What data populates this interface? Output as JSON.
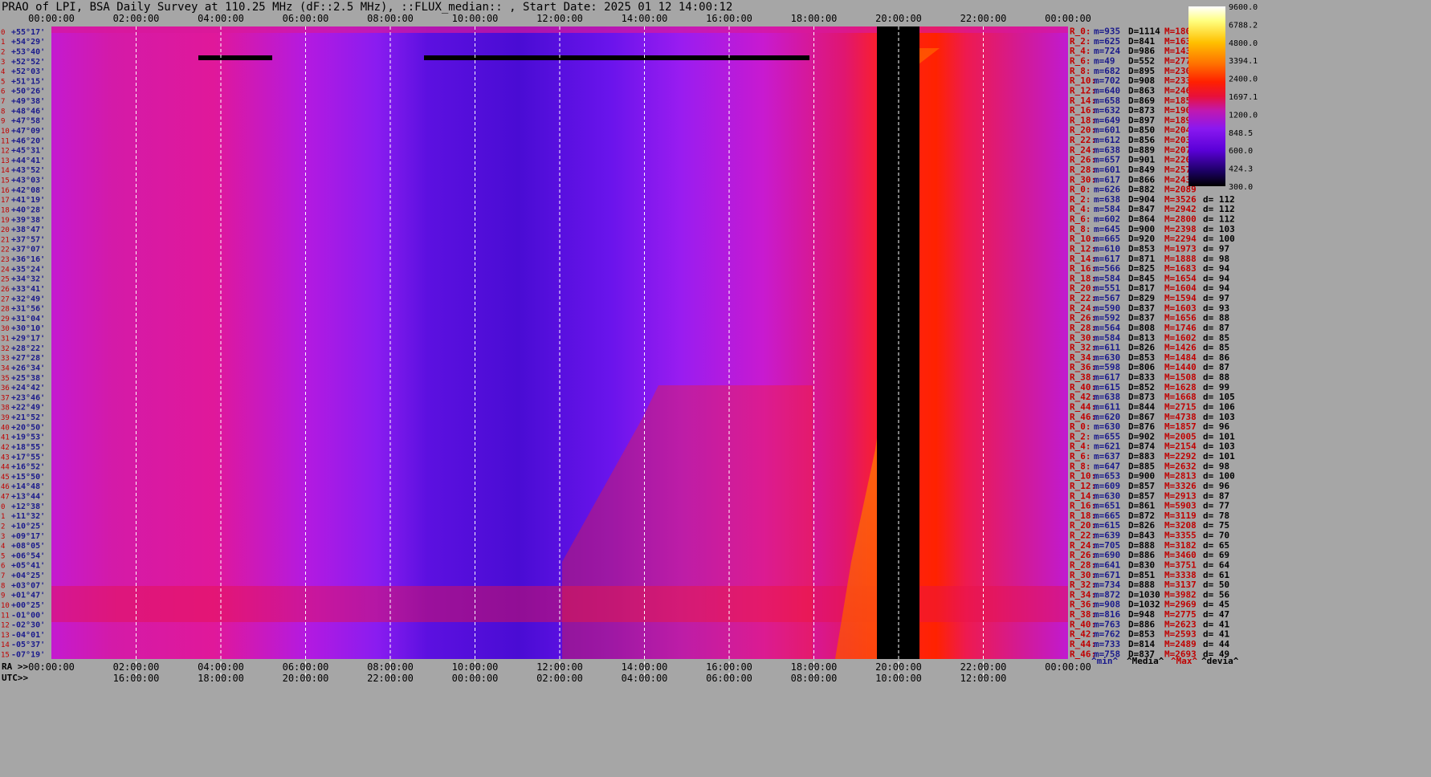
{
  "header": {
    "title": "PRAO of LPI, BSA Daily Survey at 110.25 MHz (dF::2.5 MHz), ::FLUX_median:: , Start Date: 2025 01 12 14:00:12"
  },
  "chart_data": {
    "type": "heatmap",
    "title": "PRAO of LPI, BSA Daily Survey at 110.25 MHz (dF::2.5 MHz), ::FLUX_median:: , Start Date: 2025 01 12 14:00:12",
    "x_axis_ra": {
      "prefix": "RA >>",
      "ticks": [
        "00:00:00",
        "02:00:00",
        "04:00:00",
        "06:00:00",
        "08:00:00",
        "10:00:00",
        "12:00:00",
        "14:00:00",
        "16:00:00",
        "18:00:00",
        "20:00:00",
        "22:00:00",
        "00:00:00"
      ],
      "range_hours": [
        0,
        24
      ]
    },
    "x_axis_utc": {
      "prefix": "UTC>>",
      "ticks": [
        "16:00:00",
        "18:00:00",
        "20:00:00",
        "22:00:00",
        "00:00:00",
        "02:00:00",
        "04:00:00",
        "06:00:00",
        "08:00:00",
        "10:00:00",
        "12:00:00"
      ]
    },
    "y_axis_declinations": [
      "+55°17'",
      "+54°29'",
      "+53°40'",
      "+52°52'",
      "+52°03'",
      "+51°15'",
      "+50°26'",
      "+49°38'",
      "+48°46'",
      "+47°58'",
      "+47°09'",
      "+46°20'",
      "+45°31'",
      "+44°41'",
      "+43°52'",
      "+43°03'",
      "+42°08'",
      "+41°19'",
      "+40°28'",
      "+39°38'",
      "+38°47'",
      "+37°57'",
      "+37°07'",
      "+36°16'",
      "+35°24'",
      "+34°32'",
      "+33°41'",
      "+32°49'",
      "+31°56'",
      "+31°04'",
      "+30°10'",
      "+29°17'",
      "+28°22'",
      "+27°28'",
      "+26°34'",
      "+25°38'",
      "+24°42'",
      "+23°46'",
      "+22°49'",
      "+21°52'",
      "+20°50'",
      "+19°53'",
      "+18°55'",
      "+17°55'",
      "+16°52'",
      "+15°50'",
      "+14°48'",
      "+13°44'",
      "+12°38'",
      "+11°32'",
      "+10°25'",
      "+09°17'",
      "+08°05'",
      "+06°54'",
      "+05°41'",
      "+04°25'",
      "+03°07'",
      "+01°47'",
      "+00°25'",
      "-01°00'",
      "-02°30'",
      "-04°01'",
      "-05°37'",
      "-07°19'"
    ],
    "colorbar": {
      "ticks": [
        "9600.0",
        "6788.2",
        "4800.0",
        "3394.1",
        "2400.0",
        "1697.1",
        "1200.0",
        "848.5",
        "600.0",
        "424.3",
        "300.0"
      ],
      "range": [
        300,
        9600
      ],
      "scale": "log",
      "colormap": [
        "#000000",
        "#1a0060",
        "#5a00d8",
        "#8a18f0",
        "#c018b0",
        "#e8103a",
        "#ff2000",
        "#ff7000",
        "#ffc000",
        "#ffff80",
        "#ffffff"
      ]
    },
    "stats": [
      {
        "r": "R_0:",
        "m": "m=935",
        "d": "D=1114",
        "h": "M=180",
        "dv": ""
      },
      {
        "r": "R_2:",
        "m": "m=625",
        "d": "D=841",
        "h": "M=1630",
        "dv": ""
      },
      {
        "r": "R_4:",
        "m": "m=724",
        "d": "D=986",
        "h": "M=1430",
        "dv": ""
      },
      {
        "r": "R_6:",
        "m": "m=49",
        "d": "D=552",
        "h": "M=2774",
        "dv": ""
      },
      {
        "r": "R_8:",
        "m": "m=682",
        "d": "D=895",
        "h": "M=2304",
        "dv": ""
      },
      {
        "r": "R_10:",
        "m": "m=702",
        "d": "D=908",
        "h": "M=233",
        "dv": ""
      },
      {
        "r": "R_12:",
        "m": "m=640",
        "d": "D=863",
        "h": "M=246",
        "dv": ""
      },
      {
        "r": "R_14:",
        "m": "m=658",
        "d": "D=869",
        "h": "M=185",
        "dv": ""
      },
      {
        "r": "R_16:",
        "m": "m=632",
        "d": "D=873",
        "h": "M=190",
        "dv": ""
      },
      {
        "r": "R_18:",
        "m": "m=649",
        "d": "D=897",
        "h": "M=189",
        "dv": ""
      },
      {
        "r": "R_20:",
        "m": "m=601",
        "d": "D=850",
        "h": "M=204",
        "dv": ""
      },
      {
        "r": "R_22:",
        "m": "m=612",
        "d": "D=856",
        "h": "M=203",
        "dv": ""
      },
      {
        "r": "R_24:",
        "m": "m=638",
        "d": "D=889",
        "h": "M=207",
        "dv": ""
      },
      {
        "r": "R_26:",
        "m": "m=657",
        "d": "D=901",
        "h": "M=220",
        "dv": ""
      },
      {
        "r": "R_28:",
        "m": "m=601",
        "d": "D=849",
        "h": "M=257",
        "dv": ""
      },
      {
        "r": "R_30:",
        "m": "m=617",
        "d": "D=866",
        "h": "M=243",
        "dv": ""
      },
      {
        "r": "R_0:",
        "m": "m=626",
        "d": "D=882",
        "h": "M=2089",
        "dv": ""
      },
      {
        "r": "R_2:",
        "m": "m=638",
        "d": "D=904",
        "h": "M=3526",
        "dv": "d= 112"
      },
      {
        "r": "R_4:",
        "m": "m=584",
        "d": "D=847",
        "h": "M=2942",
        "dv": "d= 112"
      },
      {
        "r": "R_6:",
        "m": "m=602",
        "d": "D=864",
        "h": "M=2800",
        "dv": "d= 112"
      },
      {
        "r": "R_8:",
        "m": "m=645",
        "d": "D=900",
        "h": "M=2398",
        "dv": "d= 103"
      },
      {
        "r": "R_10:",
        "m": "m=665",
        "d": "D=920",
        "h": "M=2294",
        "dv": "d= 100"
      },
      {
        "r": "R_12:",
        "m": "m=610",
        "d": "D=853",
        "h": "M=1973",
        "dv": "d= 97"
      },
      {
        "r": "R_14:",
        "m": "m=617",
        "d": "D=871",
        "h": "M=1888",
        "dv": "d= 98"
      },
      {
        "r": "R_16:",
        "m": "m=566",
        "d": "D=825",
        "h": "M=1683",
        "dv": "d= 94"
      },
      {
        "r": "R_18:",
        "m": "m=584",
        "d": "D=845",
        "h": "M=1654",
        "dv": "d= 94"
      },
      {
        "r": "R_20:",
        "m": "m=551",
        "d": "D=817",
        "h": "M=1604",
        "dv": "d= 94"
      },
      {
        "r": "R_22:",
        "m": "m=567",
        "d": "D=829",
        "h": "M=1594",
        "dv": "d= 97"
      },
      {
        "r": "R_24:",
        "m": "m=590",
        "d": "D=837",
        "h": "M=1603",
        "dv": "d= 93"
      },
      {
        "r": "R_26:",
        "m": "m=592",
        "d": "D=837",
        "h": "M=1656",
        "dv": "d= 88"
      },
      {
        "r": "R_28:",
        "m": "m=564",
        "d": "D=808",
        "h": "M=1746",
        "dv": "d= 87"
      },
      {
        "r": "R_30:",
        "m": "m=584",
        "d": "D=813",
        "h": "M=1602",
        "dv": "d= 85"
      },
      {
        "r": "R_32:",
        "m": "m=611",
        "d": "D=826",
        "h": "M=1426",
        "dv": "d= 85"
      },
      {
        "r": "R_34:",
        "m": "m=630",
        "d": "D=853",
        "h": "M=1484",
        "dv": "d= 86"
      },
      {
        "r": "R_36:",
        "m": "m=598",
        "d": "D=806",
        "h": "M=1440",
        "dv": "d= 87"
      },
      {
        "r": "R_38:",
        "m": "m=617",
        "d": "D=833",
        "h": "M=1508",
        "dv": "d= 88"
      },
      {
        "r": "R_40:",
        "m": "m=615",
        "d": "D=852",
        "h": "M=1628",
        "dv": "d= 99"
      },
      {
        "r": "R_42:",
        "m": "m=638",
        "d": "D=873",
        "h": "M=1668",
        "dv": "d= 105"
      },
      {
        "r": "R_44:",
        "m": "m=611",
        "d": "D=844",
        "h": "M=2715",
        "dv": "d= 106"
      },
      {
        "r": "R_46:",
        "m": "m=620",
        "d": "D=867",
        "h": "M=4738",
        "dv": "d= 103"
      },
      {
        "r": "R_0:",
        "m": "m=630",
        "d": "D=876",
        "h": "M=1857",
        "dv": "d= 96"
      },
      {
        "r": "R_2:",
        "m": "m=655",
        "d": "D=902",
        "h": "M=2005",
        "dv": "d= 101"
      },
      {
        "r": "R_4:",
        "m": "m=621",
        "d": "D=874",
        "h": "M=2154",
        "dv": "d= 103"
      },
      {
        "r": "R_6:",
        "m": "m=637",
        "d": "D=883",
        "h": "M=2292",
        "dv": "d= 101"
      },
      {
        "r": "R_8:",
        "m": "m=647",
        "d": "D=885",
        "h": "M=2632",
        "dv": "d= 98"
      },
      {
        "r": "R_10:",
        "m": "m=653",
        "d": "D=900",
        "h": "M=2813",
        "dv": "d= 100"
      },
      {
        "r": "R_12:",
        "m": "m=609",
        "d": "D=857",
        "h": "M=3326",
        "dv": "d= 96"
      },
      {
        "r": "R_14:",
        "m": "m=630",
        "d": "D=857",
        "h": "M=2913",
        "dv": "d= 87"
      },
      {
        "r": "R_16:",
        "m": "m=651",
        "d": "D=861",
        "h": "M=5903",
        "dv": "d= 77"
      },
      {
        "r": "R_18:",
        "m": "m=665",
        "d": "D=872",
        "h": "M=3119",
        "dv": "d= 78"
      },
      {
        "r": "R_20:",
        "m": "m=615",
        "d": "D=826",
        "h": "M=3208",
        "dv": "d= 75"
      },
      {
        "r": "R_22:",
        "m": "m=639",
        "d": "D=843",
        "h": "M=3355",
        "dv": "d= 70"
      },
      {
        "r": "R_24:",
        "m": "m=705",
        "d": "D=888",
        "h": "M=3182",
        "dv": "d= 65"
      },
      {
        "r": "R_26:",
        "m": "m=690",
        "d": "D=886",
        "h": "M=3460",
        "dv": "d= 69"
      },
      {
        "r": "R_28:",
        "m": "m=641",
        "d": "D=830",
        "h": "M=3751",
        "dv": "d= 64"
      },
      {
        "r": "R_30:",
        "m": "m=671",
        "d": "D=851",
        "h": "M=3338",
        "dv": "d= 61"
      },
      {
        "r": "R_32:",
        "m": "m=734",
        "d": "D=888",
        "h": "M=3137",
        "dv": "d= 50"
      },
      {
        "r": "R_34:",
        "m": "m=872",
        "d": "D=1030",
        "h": "M=3982",
        "dv": "d= 56"
      },
      {
        "r": "R_36:",
        "m": "m=908",
        "d": "D=1032",
        "h": "M=2969",
        "dv": "d= 45"
      },
      {
        "r": "R_38:",
        "m": "m=816",
        "d": "D=948",
        "h": "M=2775",
        "dv": "d= 47"
      },
      {
        "r": "R_40:",
        "m": "m=763",
        "d": "D=886",
        "h": "M=2623",
        "dv": "d= 41"
      },
      {
        "r": "R_42:",
        "m": "m=762",
        "d": "D=853",
        "h": "M=2593",
        "dv": "d= 41"
      },
      {
        "r": "R_44:",
        "m": "m=733",
        "d": "D=814",
        "h": "M=2489",
        "dv": "d= 44"
      },
      {
        "r": "R_46:",
        "m": "m=758",
        "d": "D=837",
        "h": "M=2693",
        "dv": "d= 49"
      }
    ],
    "stats_legend": [
      "^min^",
      "^Media^",
      "^Max^",
      "^devia^"
    ],
    "colors": {
      "background": "#a6a6a6",
      "region_label": "#c00000",
      "min_label": "#1a1a8c",
      "media_label": "#000000",
      "max_label": "#c00000",
      "devia_label": "#000000",
      "gridline": "#ffffff"
    }
  }
}
